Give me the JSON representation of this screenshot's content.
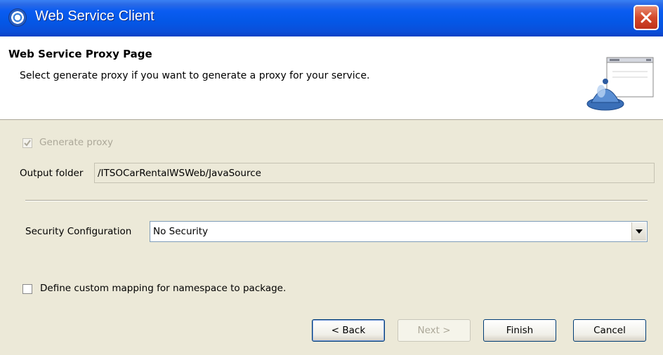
{
  "window": {
    "title": "Web Service Client"
  },
  "banner": {
    "title": "Web Service Proxy Page",
    "description": "Select generate proxy if you want to generate a proxy for your service."
  },
  "form": {
    "generate_proxy_label": "Generate proxy",
    "generate_proxy_checked": true,
    "output_folder_label": "Output folder",
    "output_folder_value": "/ITSOCarRentalWSWeb/JavaSource",
    "security_config_label": "Security Configuration",
    "security_config_value": "No Security",
    "custom_mapping_label": "Define custom mapping for namespace to package.",
    "custom_mapping_checked": false
  },
  "buttons": {
    "back": "< Back",
    "next": "Next >",
    "finish": "Finish",
    "cancel": "Cancel"
  },
  "icons": {
    "app": "web-service-client-icon",
    "close": "close-icon",
    "wizard": "wizard-banner-icon",
    "dropdown": "chevron-down-icon"
  },
  "colors": {
    "titlebar": "#0457e6",
    "dialog_bg": "#ece9d8",
    "close_button": "#d4492b",
    "disabled_text": "#aca899"
  }
}
